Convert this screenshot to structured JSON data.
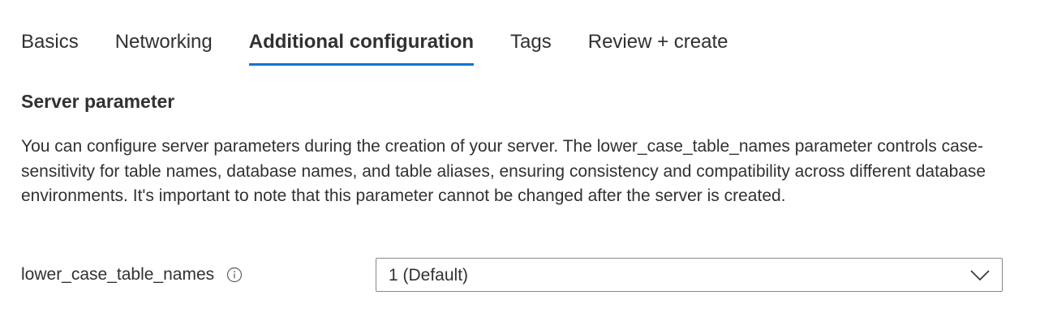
{
  "tabs": [
    {
      "label": "Basics",
      "active": false
    },
    {
      "label": "Networking",
      "active": false
    },
    {
      "label": "Additional configuration",
      "active": true
    },
    {
      "label": "Tags",
      "active": false
    },
    {
      "label": "Review + create",
      "active": false
    }
  ],
  "section": {
    "title": "Server parameter",
    "description": "You can configure server parameters during the creation of your server. The lower_case_table_names parameter controls case-sensitivity for table names, database names, and table aliases, ensuring consistency and compatibility across different database environments. It's important to note that this parameter cannot be changed after the server is created."
  },
  "field": {
    "label": "lower_case_table_names",
    "info_icon": "info-icon",
    "selected_value": "1 (Default)",
    "chevron_icon": "chevron-down-icon"
  },
  "colors": {
    "accent": "#0078d4",
    "text": "#323130",
    "border": "#8a8886"
  }
}
